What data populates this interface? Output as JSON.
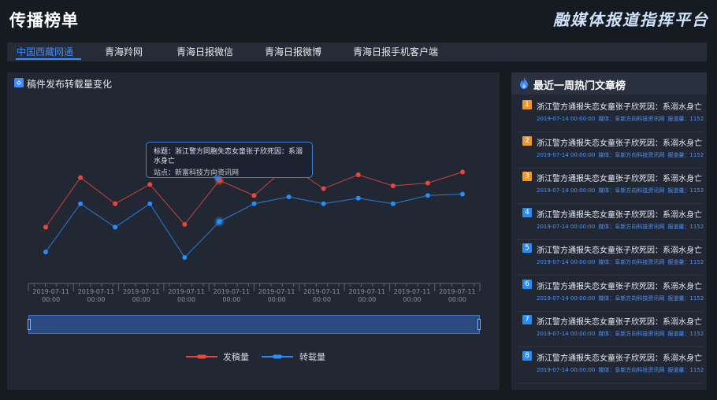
{
  "header": {
    "title": "传播榜单",
    "brand": "融媒体报道指挥平台"
  },
  "tabs": [
    {
      "label": "中国西藏网通",
      "active": true
    },
    {
      "label": "青海羚网",
      "active": false
    },
    {
      "label": "青海日报微信",
      "active": false
    },
    {
      "label": "青海日报微博",
      "active": false
    },
    {
      "label": "青海日报手机客户端",
      "active": false
    }
  ],
  "left_panel": {
    "title": "稿件发布转载量变化"
  },
  "tooltip": {
    "title": "标题：浙江警方同胞失恋女童张子欣死因：系溺水身亡",
    "site": "站点：新富科技方向资讯网"
  },
  "legend": {
    "series1": "发稿量",
    "series2": "转载量"
  },
  "right_panel": {
    "title": "最近一周热门文章榜"
  },
  "articles": [
    {
      "rank": "1",
      "title": "浙江警方通报失恋女童张子欣死因：系溺水身亡",
      "date": "2019-07-14 00:00:00",
      "media": "媒体：阜新方向科技资讯网",
      "reposts": "报道量：1152"
    },
    {
      "rank": "2",
      "title": "浙江警方通报失恋女童张子欣死因：系溺水身亡",
      "date": "2019-07-14 00:00:00",
      "media": "媒体：阜新方向科技资讯网",
      "reposts": "报道量：1152"
    },
    {
      "rank": "3",
      "title": "浙江警方通报失恋女童张子欣死因：系溺水身亡",
      "date": "2019-07-14 00:00:00",
      "media": "媒体：阜新方向科技资讯网",
      "reposts": "报道量：1152"
    },
    {
      "rank": "4",
      "title": "浙江警方通报失恋女童张子欣死因：系溺水身亡",
      "date": "2019-07-14 00:00:00",
      "media": "媒体：阜新方向科技资讯网",
      "reposts": "报道量：1152"
    },
    {
      "rank": "5",
      "title": "浙江警方通报失恋女童张子欣死因：系溺水身亡",
      "date": "2019-07-14 00:00:00",
      "media": "媒体：阜新方向科技资讯网",
      "reposts": "报道量：1152"
    },
    {
      "rank": "6",
      "title": "浙江警方通报失恋女童张子欣死因：系溺水身亡",
      "date": "2019-07-14 00:00:00",
      "media": "媒体：阜新方向科技资讯网",
      "reposts": "报道量：1152"
    },
    {
      "rank": "7",
      "title": "浙江警方通报失恋女童张子欣死因：系溺水身亡",
      "date": "2019-07-14 00:00:00",
      "media": "媒体：阜新方向科技资讯网",
      "reposts": "报道量：1152"
    },
    {
      "rank": "8",
      "title": "浙江警方通报失恋女童张子欣死因：系溺水身亡",
      "date": "2019-07-14 00:00:00",
      "media": "媒体：阜新方向科技资讯网",
      "reposts": "报道量：1152"
    }
  ],
  "colors": {
    "accent": "#3d8bff",
    "series1": "#e8473d",
    "series2": "#2a8cf5",
    "badge_top": "#f0962a",
    "badge_rest": "#2a8cf5"
  },
  "chart_data": {
    "type": "line",
    "x_labels": [
      "2019-07-11 00:00",
      "2019-07-11 00:00",
      "2019-07-11 00:00",
      "2019-07-11 00:00",
      "2019-07-11 00:00",
      "2019-07-11 00:00",
      "2019-07-11 00:00",
      "2019-07-11 00:00",
      "2019-07-11 00:00",
      "2019-07-11 00:00"
    ],
    "series": [
      {
        "name": "发稿量",
        "color": "#e8473d",
        "values": [
          42,
          78,
          59,
          73,
          44,
          76,
          65,
          87,
          70,
          80,
          72,
          74,
          82
        ]
      },
      {
        "name": "转载量",
        "color": "#2a8cf5",
        "values": [
          24,
          59,
          42,
          59,
          20,
          46,
          59,
          64,
          59,
          63,
          59,
          65,
          66
        ]
      }
    ],
    "highlight_index": 5,
    "ylim": [
      0,
      100
    ],
    "grid": false,
    "legend_position": "bottom"
  }
}
